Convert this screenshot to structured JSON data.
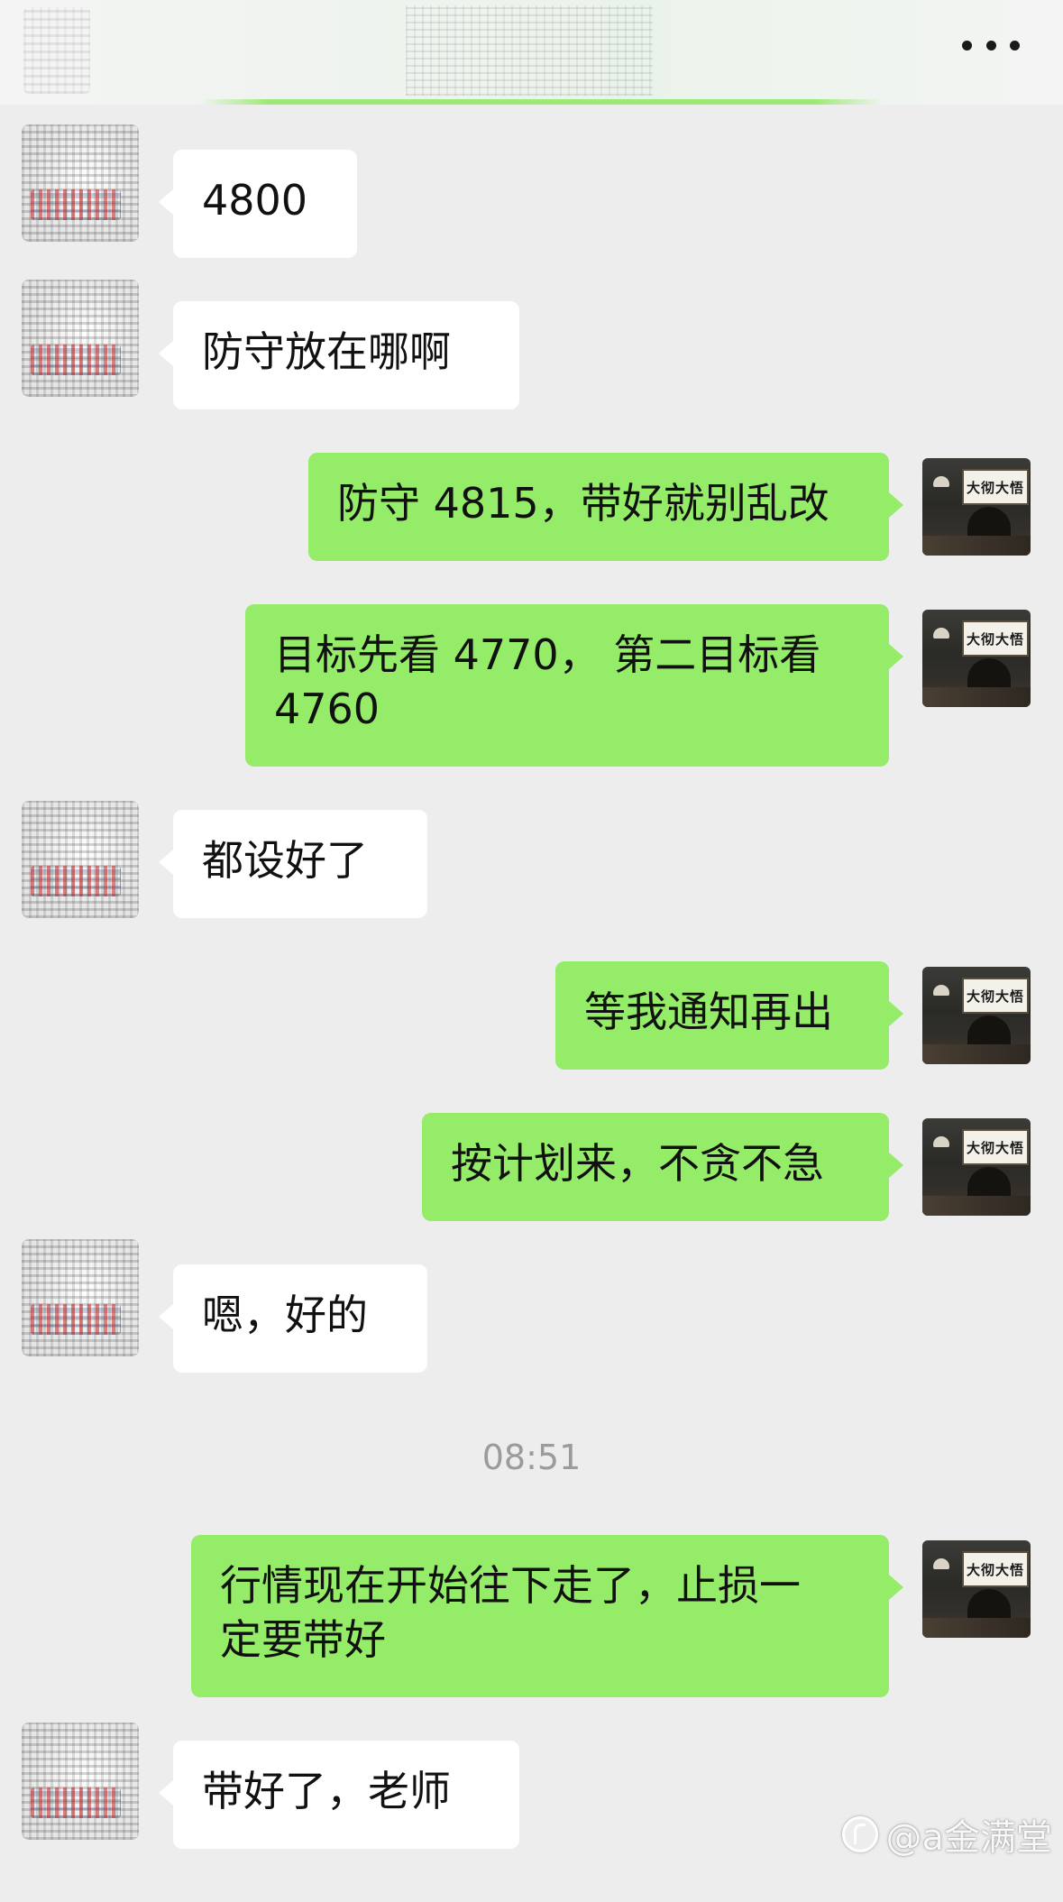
{
  "header": {
    "title": "",
    "more_icon": "more-dots-icon",
    "back_icon": "back-chevron-icon"
  },
  "colors": {
    "background": "#ededed",
    "incoming_bubble": "#ffffff",
    "outgoing_bubble": "#95ec69",
    "timestamp_text": "#9b9b9b"
  },
  "messages": [
    {
      "side": "left",
      "text": "4800"
    },
    {
      "side": "left",
      "text": "防守放在哪啊"
    },
    {
      "side": "right",
      "text": "防守 4815，带好就别乱改",
      "avatar_sign": "大彻大悟"
    },
    {
      "side": "right",
      "text": "目标先看 4770， 第二目标看\n4760",
      "avatar_sign": "大彻大悟"
    },
    {
      "side": "left",
      "text": "都设好了"
    },
    {
      "side": "right",
      "text": "等我通知再出",
      "avatar_sign": "大彻大悟"
    },
    {
      "side": "right",
      "text": "按计划来，不贪不急",
      "avatar_sign": "大彻大悟"
    },
    {
      "side": "left",
      "text": "嗯，好的"
    },
    {
      "side": "right",
      "text": "行情现在开始往下走了，止损一\n定要带好",
      "avatar_sign": "大彻大悟"
    },
    {
      "side": "left",
      "text": "带好了，老师"
    }
  ],
  "timestamp": "08:51",
  "watermark": "@a金满堂"
}
